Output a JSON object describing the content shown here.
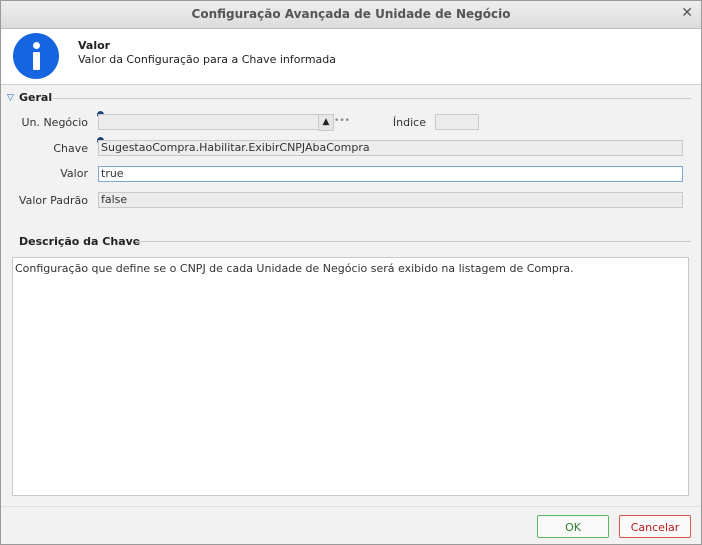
{
  "window": {
    "title": "Configuração Avançada de Unidade de Negócio",
    "close_glyph": "✕"
  },
  "header": {
    "title": "Valor",
    "subtitle": "Valor da Configuração para a Chave informada",
    "icon": "info-icon"
  },
  "geral": {
    "title": "Geral",
    "un_negocio": {
      "label": "Un. Negócio",
      "value": ""
    },
    "indice": {
      "label": "Índice",
      "value": ""
    },
    "chave": {
      "label": "Chave",
      "value": "SugestaoCompra.Habilitar.ExibirCNPJAbaCompra"
    },
    "valor": {
      "label": "Valor",
      "value": "true"
    },
    "valor_padrao": {
      "label": "Valor Padrão",
      "value": "false"
    }
  },
  "descricao": {
    "title": "Descrição da Chave",
    "text": "Configuração que define se o CNPJ de cada Unidade de Negócio será exibido na listagem de Compra."
  },
  "buttons": {
    "ok": "OK",
    "cancel": "Cancelar"
  },
  "colors": {
    "accent": "#1565e0",
    "ok_border": "#5cb85c",
    "cancel_border": "#d9534f"
  }
}
